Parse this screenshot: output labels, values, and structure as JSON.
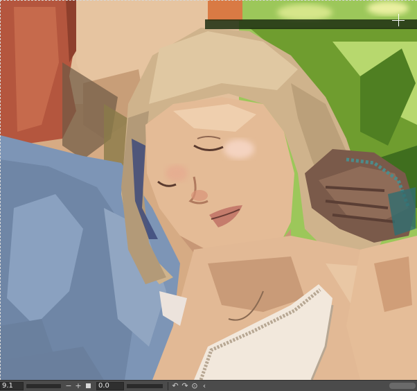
{
  "statusbar": {
    "zoom_value": "9.1",
    "zoom_out_icon": "minus",
    "zoom_in_icon": "plus",
    "fit_icon": "square",
    "angle_value": "0.0",
    "rotate_left_icon": "↶",
    "rotate_right_icon": "↷",
    "reset_rotation_icon": "⊙",
    "flip_icon": "‹"
  },
  "colors": {
    "sleeve": "#7d95b6",
    "skin": "#e2b995",
    "hair": "#cfb38c",
    "foliage": "#8cbf48",
    "red_garment": "#b4563e",
    "statusbar_bg": "#4b4b4b"
  }
}
